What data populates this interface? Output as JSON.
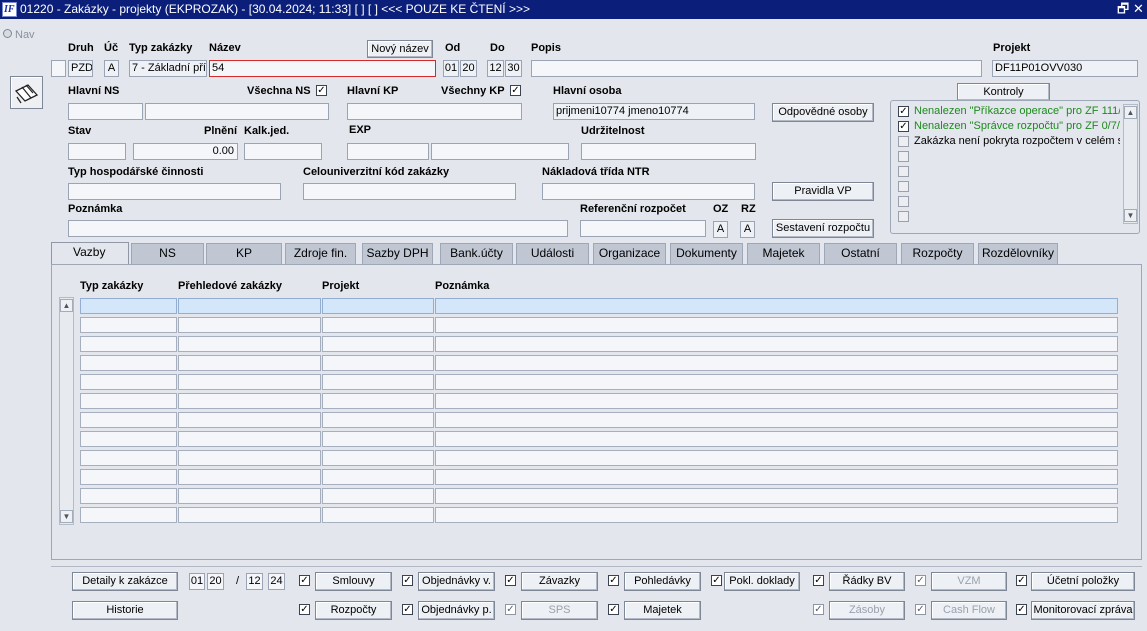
{
  "window": {
    "title": "01220 - Zakázky - projekty (EKPROZAK) - [30.04.2024; 11:33]  [ ] [ ] <<< POUZE KE ČTENÍ >>>",
    "restore": "🗗",
    "close": "✕",
    "logo": "IF"
  },
  "nav": {
    "label": "Nav"
  },
  "header": {
    "druh": {
      "label": "Druh",
      "value": "PZD"
    },
    "uc": {
      "label": "Úč",
      "value": "A"
    },
    "typ_zakazky": {
      "label": "Typ zakázky",
      "value": "7 - Základní pří"
    },
    "nazev": {
      "label": "Název",
      "value": "54"
    },
    "novy_nazev": "Nový název",
    "od": {
      "label": "Od",
      "month": "01",
      "year": "20"
    },
    "do": {
      "label": "Do",
      "month": "12",
      "year": "30"
    },
    "popis": {
      "label": "Popis",
      "value": ""
    },
    "projekt": {
      "label": "Projekt",
      "value": "DF11P01OVV030"
    },
    "kontroly": "Kontroly",
    "hlavni_ns": {
      "label": "Hlavní NS",
      "code": "",
      "name": ""
    },
    "vsechna_ns": "Všechna NS",
    "hlavni_kp": {
      "label": "Hlavní KP",
      "value": ""
    },
    "vsechny_kp": "Všechny KP",
    "hlavni_osoba": {
      "label": "Hlavní osoba",
      "value": "prijmeni10774 jmeno10774"
    },
    "odpovedne_osoby": "Odpovědné osoby",
    "stav": {
      "label": "Stav",
      "value": ""
    },
    "plneni": {
      "label": "Plnění",
      "value": "0.00"
    },
    "kalk_jed": {
      "label": "Kalk.jed.",
      "value": ""
    },
    "exp": {
      "label": "EXP",
      "code": "",
      "name": ""
    },
    "udrzitelnost": {
      "label": "Udržitelnost",
      "value": ""
    },
    "typ_hosp": {
      "label": "Typ hospodářské činnosti",
      "value": ""
    },
    "celouniverzitni": {
      "label": "Celouniverzitní kód zakázky",
      "value": ""
    },
    "nakladova_trida": {
      "label": "Nákladová třída NTR",
      "value": ""
    },
    "pravidla_vp": "Pravidla VP",
    "poznamka": {
      "label": "Poznámka",
      "value": ""
    },
    "referencni": {
      "label": "Referenční rozpočet",
      "value": ""
    },
    "oz": {
      "label": "OZ",
      "value": "A"
    },
    "rz": {
      "label": "RZ",
      "value": "A"
    },
    "sestaveni": "Sestavení rozpočtu"
  },
  "kontroly_list": [
    {
      "text": "Nenalezen \"Příkazce operace\" pro ZF 111/",
      "checked": true
    },
    {
      "text": "Nenalezen \"Správce rozpočtu\" pro ZF 0/7/",
      "checked": true
    },
    {
      "text": "Zakázka není pokryta rozpočtem v celém s",
      "checked": false
    },
    {
      "text": "",
      "checked": false
    },
    {
      "text": "",
      "checked": false
    },
    {
      "text": "",
      "checked": false
    },
    {
      "text": "",
      "checked": false
    },
    {
      "text": "",
      "checked": false
    }
  ],
  "tabs": [
    "Vazby",
    "NS",
    "KP",
    "Zdroje fin.",
    "Sazby DPH",
    "Bank.účty",
    "Události",
    "Organizace",
    "Dokumenty",
    "Majetek",
    "Ostatní",
    "Rozpočty",
    "Rozdělovníky"
  ],
  "grid": {
    "columns": [
      "Typ zakázky",
      "Přehledové zakázky",
      "Projekt",
      "Poznámka"
    ],
    "rows": 12
  },
  "footer": {
    "detaily": "Detaily k zakázce",
    "historie": "Historie",
    "od_month": "01",
    "od_year": "20",
    "separator": "/",
    "do_month": "12",
    "do_year": "24",
    "row1": [
      {
        "label": "Smlouvy",
        "checked": true,
        "disabled": false
      },
      {
        "label": "Objednávky v.",
        "checked": true,
        "disabled": false
      },
      {
        "label": "Závazky",
        "checked": true,
        "disabled": false
      },
      {
        "label": "Pohledávky",
        "checked": true,
        "disabled": false
      },
      {
        "label": "Pokl. doklady",
        "checked": true,
        "disabled": false
      },
      {
        "label": "Řádky BV",
        "checked": true,
        "disabled": false
      },
      {
        "label": "VZM",
        "checked": true,
        "disabled": true
      },
      {
        "label": "Účetní položky",
        "checked": true,
        "disabled": false
      }
    ],
    "row2": [
      {
        "label": "Rozpočty",
        "checked": true,
        "disabled": false
      },
      {
        "label": "Objednávky p.",
        "checked": true,
        "disabled": false
      },
      {
        "label": "SPS",
        "checked": true,
        "disabled": true
      },
      {
        "label": "Majetek",
        "checked": true,
        "disabled": false
      },
      {
        "label": "Zásoby",
        "checked": true,
        "disabled": true
      },
      {
        "label": "Cash Flow",
        "checked": true,
        "disabled": true
      },
      {
        "label": "Monitorovací zpráva",
        "checked": true,
        "disabled": false
      }
    ]
  }
}
